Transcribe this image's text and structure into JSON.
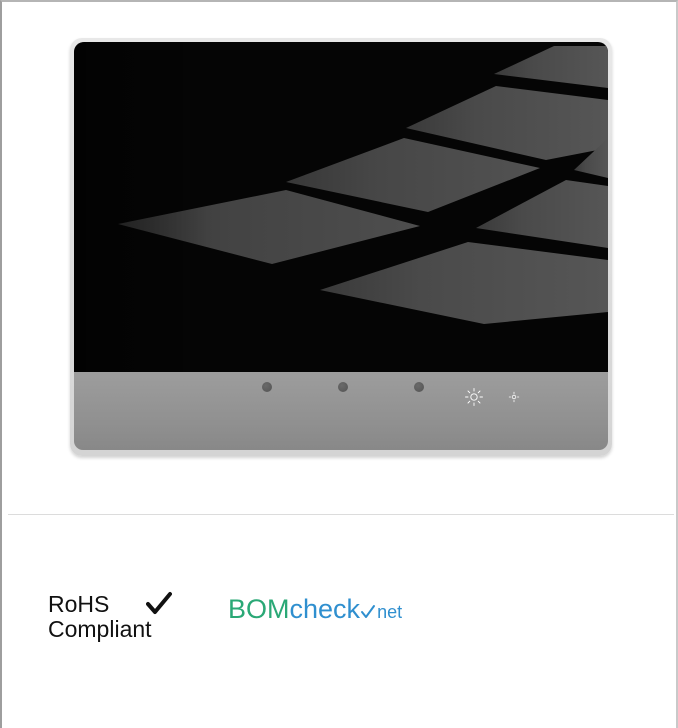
{
  "compliance": {
    "rohs_line1": "RoHS",
    "rohs_line2": "Compliant",
    "bom_part1": "BOM",
    "bom_part2": "check",
    "bom_part3": "net"
  },
  "device": {
    "front_buttons": [
      "function-button-1",
      "function-button-2",
      "function-button-3"
    ],
    "brightness_controls": [
      "brightness-up-icon",
      "brightness-down-icon"
    ]
  },
  "colors": {
    "screen": "#050505",
    "bezel": "#949494",
    "bom_green": "#2aa876",
    "bom_blue": "#2f8fcf"
  }
}
